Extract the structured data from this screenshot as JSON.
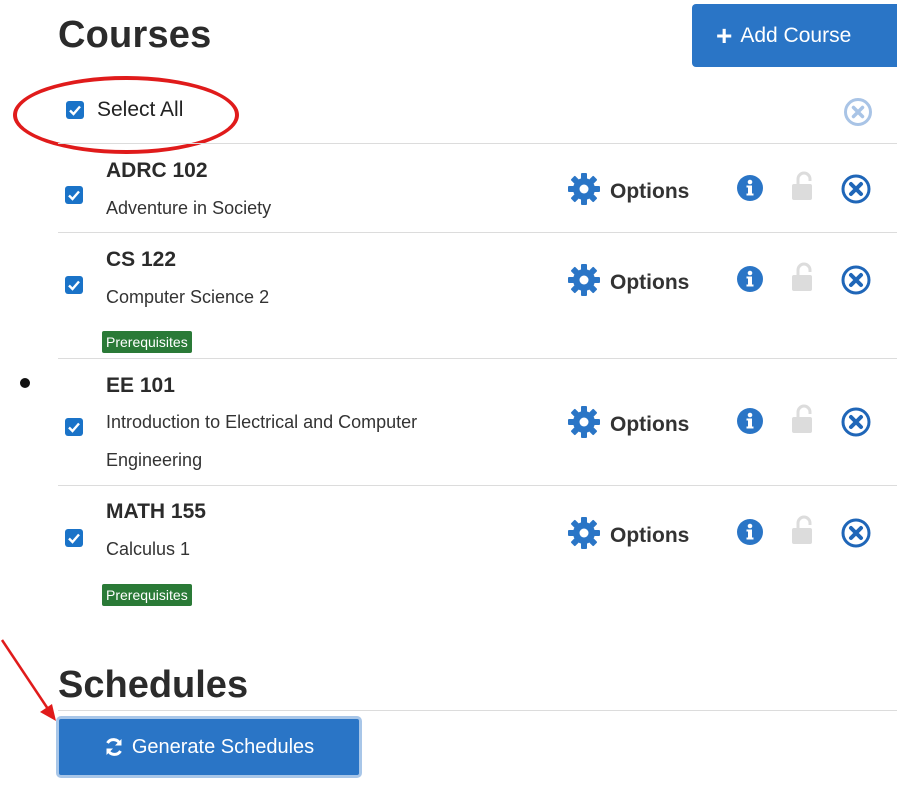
{
  "courses_section": {
    "heading": "Courses",
    "add_button": "Add Course",
    "select_all": "Select All",
    "items": [
      {
        "code": "ADRC 102",
        "title": "Adventure in Society",
        "title_line2": "",
        "prereq": "",
        "options": "Options",
        "checked": true
      },
      {
        "code": "CS 122",
        "title": "Computer Science 2",
        "title_line2": "",
        "prereq": "Prerequisites",
        "options": "Options",
        "checked": true
      },
      {
        "code": "EE 101",
        "title": "Introduction to Electrical and Computer",
        "title_line2": "Engineering",
        "prereq": "",
        "options": "Options",
        "checked": true
      },
      {
        "code": "MATH 155",
        "title": "Calculus 1",
        "title_line2": "",
        "prereq": "Prerequisites",
        "options": "Options",
        "checked": true
      }
    ]
  },
  "schedules_section": {
    "heading": "Schedules",
    "generate_button": "Generate Schedules"
  },
  "colors": {
    "accent": "#2a75c6",
    "prereq_badge": "#2a7a37",
    "annotation_red": "#e01b1b"
  },
  "icons": {
    "add": "plus-icon",
    "options": "gear-icon",
    "info": "info-icon",
    "lock": "unlock-icon",
    "remove": "remove-circle-icon",
    "generate": "refresh-icon"
  }
}
